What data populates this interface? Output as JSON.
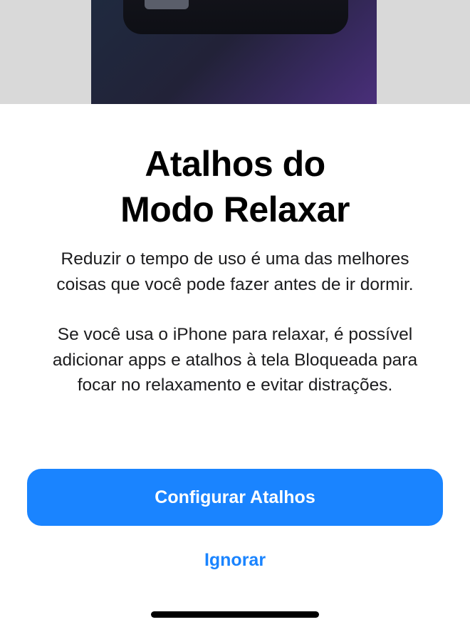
{
  "onboarding": {
    "title_line1": "Atalhos do",
    "title_line2": "Modo Relaxar",
    "paragraph1_line1": "Reduzir o tempo de uso é uma das melhores",
    "paragraph1_line2": "coisas que você pode fazer antes de ir dormir.",
    "paragraph2_line1": "Se você usa o iPhone para relaxar, é possível",
    "paragraph2_line2": "adicionar apps e atalhos à tela Bloqueada para",
    "paragraph2_line3": "focar no relaxamento e evitar distrações.",
    "primary_button_label": "Configurar Atalhos",
    "secondary_button_label": "Ignorar"
  },
  "colors": {
    "accent": "#1a84ff",
    "hero_background": "#d9d9d9",
    "hero_gradient_start": "#1f2a3f",
    "hero_gradient_end": "#4a2f7a"
  }
}
